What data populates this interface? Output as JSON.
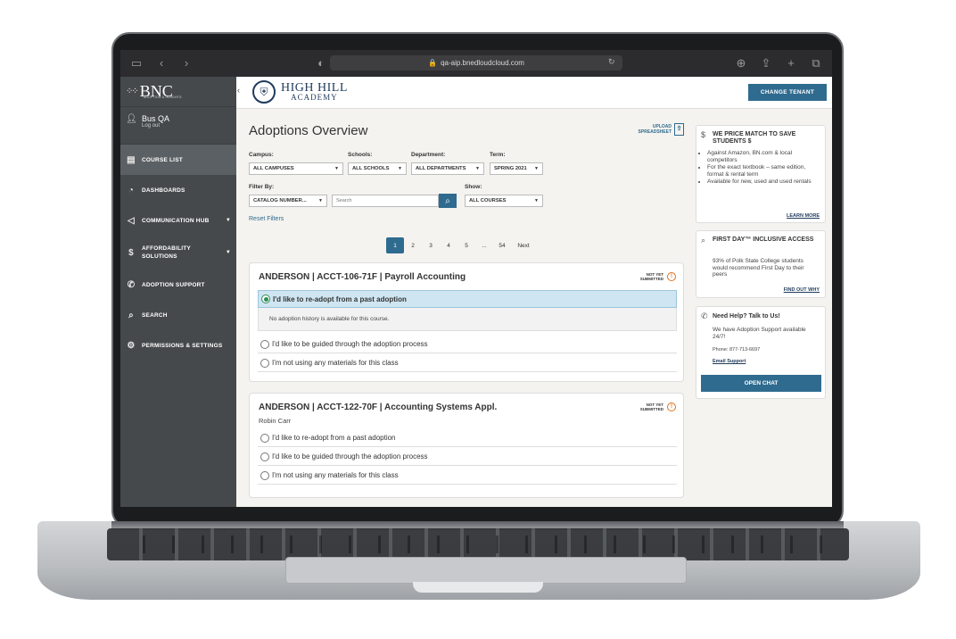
{
  "browser": {
    "url": "qa-aip.bnedloudcloud.com"
  },
  "sidebar": {
    "logo_text": "BNC",
    "logo_sub": "ADOPTION & INSIGHTS",
    "user_name": "Bus QA",
    "logout": "Log out",
    "items": [
      {
        "label": "COURSE LIST",
        "icon": "clipboard-icon"
      },
      {
        "label": "DASHBOARDS",
        "icon": "pie-chart-icon"
      },
      {
        "label": "COMMUNICATION HUB",
        "icon": "megaphone-icon"
      },
      {
        "label": "AFFORDABILITY SOLUTIONS",
        "icon": "dollar-icon"
      },
      {
        "label": "ADOPTION SUPPORT",
        "icon": "phone-icon"
      },
      {
        "label": "SEARCH",
        "icon": "search-icon"
      },
      {
        "label": "PERMISSIONS & SETTINGS",
        "icon": "gear-icon"
      }
    ]
  },
  "header": {
    "school_line1": "HIGH HILL",
    "school_line2": "ACADEMY",
    "change_tenant": "CHANGE TENANT"
  },
  "main": {
    "title": "Adoptions Overview",
    "upload_line1": "UPLOAD",
    "upload_line2": "SPREADSHEET",
    "filters": {
      "campus_label": "Campus:",
      "campus_value": "ALL CAMPUSES",
      "schools_label": "Schools:",
      "schools_value": "ALL SCHOOLS",
      "department_label": "Department:",
      "department_value": "ALL DEPARTMENTS",
      "term_label": "Term:",
      "term_value": "SPRING 2021",
      "filter_by_label": "Filter By:",
      "filter_by_value": "CATALOG NUMBER...",
      "search_placeholder": "Search",
      "show_label": "Show:",
      "show_value": "ALL COURSES",
      "reset": "Reset Filters"
    },
    "pagination": [
      "1",
      "2",
      "3",
      "4",
      "5",
      "...",
      "54",
      "Next"
    ],
    "cards": [
      {
        "title": "ANDERSON | ACCT-106-71F | Payroll Accounting",
        "status_line1": "NOT YET",
        "status_line2": "SUBMITTED",
        "options": [
          "I'd like to re-adopt from a past adoption",
          "I'd like to be guided through the adoption process",
          "I'm not using any materials for this class"
        ],
        "no_history": "No adoption history is available for this course."
      },
      {
        "title": "ANDERSON | ACCT-122-70F | Accounting Systems Appl.",
        "instructor": "Robin Carr",
        "status_line1": "NOT YET",
        "status_line2": "SUBMITTED",
        "options": [
          "I'd like to re-adopt from a past adoption",
          "I'd like to be guided through the adoption process",
          "I'm not using any materials for this class"
        ]
      }
    ]
  },
  "rail": {
    "price": {
      "title": "WE PRICE MATCH TO SAVE STUDENTS $",
      "bullets": [
        "Against Amazon, BN.com & local competitors",
        "For the exact textbook – same edition, format & rental term",
        "Available for new, used and used rentals"
      ],
      "link": "LEARN MORE"
    },
    "firstday": {
      "title": "FIRST DAY™ INCLUSIVE ACCESS",
      "text": "93% of Polk State College students would recommend First Day to their peers",
      "link": "FIND OUT WHY"
    },
    "help": {
      "title": "Need Help? Talk to Us!",
      "text": "We have Adoption Support available 24/7!",
      "phone": "Phone: 877-713-6697",
      "email": "Email Support",
      "button": "OPEN CHAT"
    }
  },
  "colors": {
    "accent": "#2f6b8f",
    "sidebar": "#45494c",
    "warning": "#e0701c",
    "selected_radio": "#2e8b57"
  }
}
